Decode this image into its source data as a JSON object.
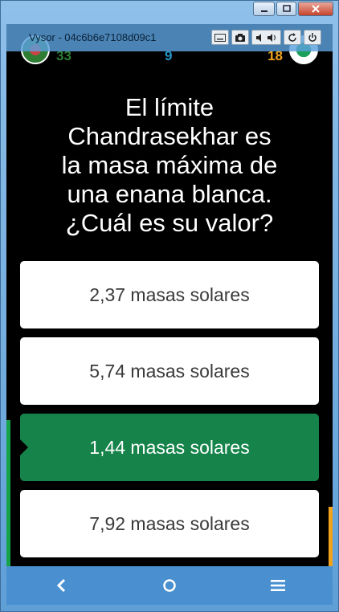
{
  "window": {
    "title": "Vysor - 04c6b6e7108d09c1"
  },
  "game": {
    "score_left": "33",
    "score_mid": "9",
    "score_right": "18"
  },
  "question": {
    "lines": [
      "El límite",
      "Chandrasekhar es",
      "la masa máxima de",
      "una enana blanca.",
      "¿Cuál es su valor?"
    ]
  },
  "answers": [
    {
      "label": "2,37 masas solares",
      "state": "default"
    },
    {
      "label": "5,74 masas solares",
      "state": "default"
    },
    {
      "label": "1,44 masas solares",
      "state": "correct"
    },
    {
      "label": "7,92 masas solares",
      "state": "default"
    }
  ],
  "progress": {
    "left_fraction": 0.27,
    "right_fraction": 0.11
  },
  "colors": {
    "correct": "#16844a",
    "navbar": "#4a90d0",
    "left_bar": "#16a34a",
    "right_bar": "#f2a21b"
  }
}
